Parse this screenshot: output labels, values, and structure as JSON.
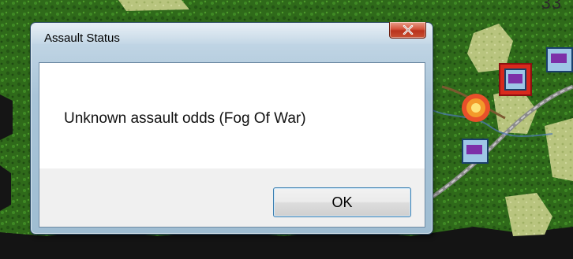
{
  "dialog": {
    "title": "Assault Status",
    "message": "Unknown assault odds (Fog Of War)",
    "ok_label": "OK",
    "close_glyph": "x"
  },
  "map": {
    "corner_text": "33"
  },
  "colors": {
    "forest_green": "#2f6a1a",
    "dialog_frame": "#a9c4d8",
    "close_button_red": "#c8432a",
    "unit_counter_purple": "#7d2fa8"
  }
}
